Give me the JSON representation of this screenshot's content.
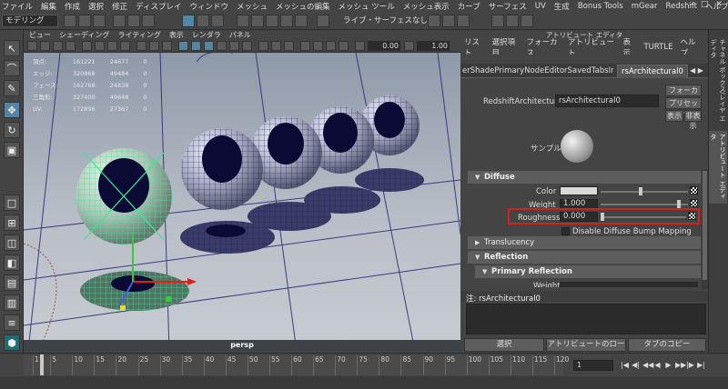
{
  "menubar": {
    "items": [
      "ファイル",
      "編集",
      "作成",
      "選択",
      "修正",
      "ディスプレイ",
      "ウィンドウ",
      "メッシュ",
      "メッシュの編集",
      "メッシュ ツール",
      "メッシュ表示",
      "カーブ",
      "サーフェス",
      "UV",
      "生成",
      "Bonus Tools",
      "mGear",
      "Redshift",
      "ヘルプ"
    ],
    "window_buttons": [
      "–",
      "□",
      "✕"
    ]
  },
  "statusline": {
    "mode": "モデリング",
    "live_label": "ライブ・サーフェスなし"
  },
  "viewport": {
    "menu": [
      "ビュー",
      "シェーディング",
      "ライティング",
      "表示",
      "レンダラ",
      "パネル"
    ],
    "field1": "0.00",
    "field2": "1.00",
    "camera": "persp",
    "hud": [
      [
        "頂点:",
        "161221",
        "24677",
        "0"
      ],
      [
        "エッジ:",
        "320868",
        "49484",
        "0"
      ],
      [
        "フェース:",
        "162768",
        "24838",
        "0"
      ],
      [
        "三角形:",
        "327400",
        "49648",
        "0"
      ],
      [
        "UV:",
        "172896",
        "27367",
        "0"
      ]
    ]
  },
  "attribute_editor": {
    "title": "アトリビュート エディタ",
    "menu": [
      "リスト",
      "選択項目",
      "フォーカス",
      "アトリビュート",
      "表示",
      "TURTLE",
      "ヘルプ"
    ],
    "tab_inactive": "erShadePrimaryNodeEditorSavedTabsInfo",
    "tab_active": "rsArchitectural0",
    "node_type_label": "RedshiftArchitectural:",
    "node_name": "rsArchitectural0",
    "focus_btn": "フォーカス",
    "preset_btn": "プリセット",
    "show_btn": "表示",
    "hide_btn": "非表示",
    "sample_label": "サンプル",
    "sections": {
      "diffuse": "Diffuse",
      "translucency": "Translucency",
      "reflection": "Reflection",
      "primary_reflection": "Primary Reflection"
    },
    "color_label": "Color",
    "weight_label": "Weight",
    "weight_value": "1.000",
    "roughness_label": "Roughness",
    "roughness_value": "0.000",
    "disable_bump_label": "Disable Diffuse Bump Mapping",
    "clipped_weight_label": "Weight",
    "notes_label": "注: rsArchitectural0",
    "bottom_buttons": [
      "選択",
      "アトリビュートのロード",
      "タブのコピー"
    ]
  },
  "side_tabs": [
    "チャネル ボックス/レイヤ エディタ",
    "アトリビュート エディタ"
  ],
  "timeline": {
    "ticks": [
      "1",
      "5",
      "10",
      "15",
      "20",
      "25",
      "30",
      "35",
      "40",
      "45",
      "50",
      "55",
      "60",
      "65",
      "70",
      "75",
      "80",
      "85",
      "90",
      "95",
      "100",
      "105",
      "110",
      "115",
      "120"
    ],
    "current_frame": "1",
    "playback_buttons": [
      "|◀",
      "◀|",
      "◀◀",
      "◀",
      "▶",
      "▶▶",
      "|▶",
      "▶|"
    ]
  }
}
